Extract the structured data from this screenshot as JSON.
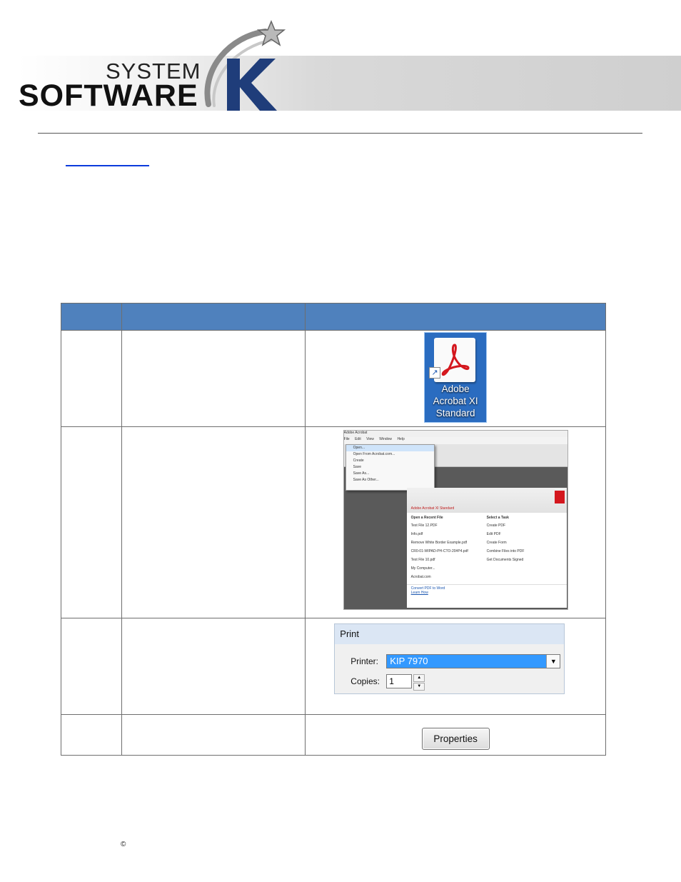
{
  "header": {
    "logo_line1": "SYSTEM",
    "logo_line2": "SOFTWARE",
    "logo_letter": "K"
  },
  "table": {
    "headers": [
      "",
      "",
      ""
    ],
    "rows": [
      {
        "step": "",
        "description": "",
        "image": "acrobat-shortcut-icon"
      },
      {
        "step": "",
        "description": "",
        "image": "acrobat-start-window"
      },
      {
        "step": "",
        "description": "",
        "image": "print-dialog"
      },
      {
        "step": "",
        "description": "",
        "image": "properties-button"
      }
    ]
  },
  "acrobat_icon": {
    "label_line1": "Adobe",
    "label_line2": "Acrobat XI",
    "label_line3": "Standard"
  },
  "acrobat_window": {
    "title": "Adobe Acrobat",
    "menu": [
      "File",
      "Edit",
      "View",
      "Window",
      "Help"
    ],
    "file_menu": [
      "Open...",
      "Open From Acrobat.com...",
      "Create",
      "Save",
      "Save As...",
      "Save As Other..."
    ],
    "panel_title": "Adobe Acrobat XI Standard",
    "recent_heading": "Open a Recent File",
    "recent_files": [
      "Test File 12.PDF",
      "Info.pdf",
      "Remove White Border Example.pdf",
      "CR0-01-WIPAD-PH-CTO-20#P4.pdf",
      "Test File 10.pdf",
      "My Computer...",
      "Acrobat.com"
    ],
    "task_heading": "Select a Task",
    "tasks": [
      "Create PDF",
      "Edit PDF",
      "Create Form",
      "Combine Files into PDF",
      "Get Documents Signed"
    ],
    "promo_title": "Convert PDF to Word",
    "promo_link": "Learn How"
  },
  "print_dialog": {
    "title": "Print",
    "printer_label": "Printer:",
    "printer_value": "KIP 7970",
    "copies_label": "Copies:",
    "copies_value": "1"
  },
  "properties_button": {
    "label": "Properties"
  },
  "footer": {
    "copyright_symbol": "©"
  },
  "colors": {
    "table_header": "#4f81bd",
    "link": "#0b3bdc",
    "icon_bg": "#2a6cc0",
    "adobe_red": "#d4171e",
    "selection_blue": "#3399ff"
  }
}
